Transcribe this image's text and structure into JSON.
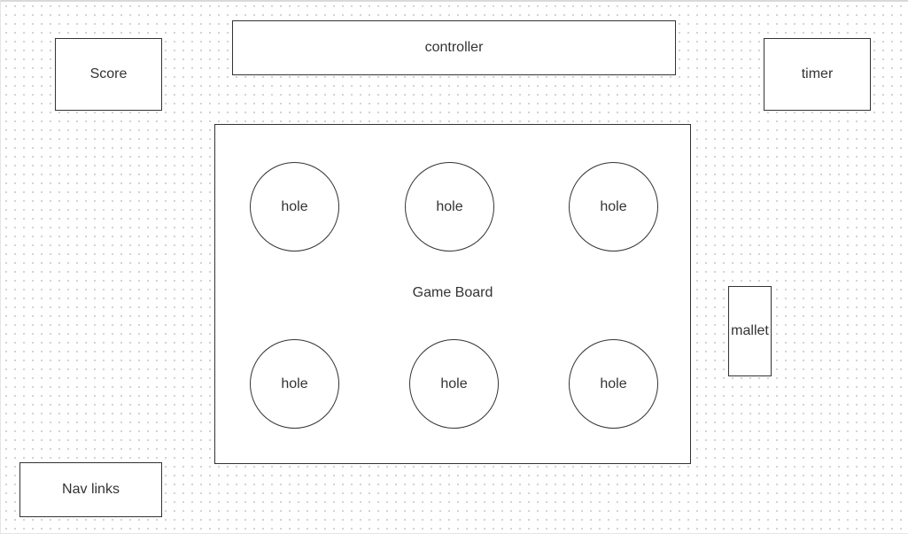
{
  "score": {
    "label": "Score"
  },
  "controller": {
    "label": "controller"
  },
  "timer": {
    "label": "timer"
  },
  "game_board": {
    "label": "Game Board",
    "holes": [
      "hole",
      "hole",
      "hole",
      "hole",
      "hole",
      "hole"
    ]
  },
  "mallet": {
    "label": "mallet"
  },
  "nav_links": {
    "label": "Nav links"
  },
  "colors": {
    "stroke": "#333333",
    "background": "#ffffff",
    "grid_dot": "#c4c4c4"
  }
}
